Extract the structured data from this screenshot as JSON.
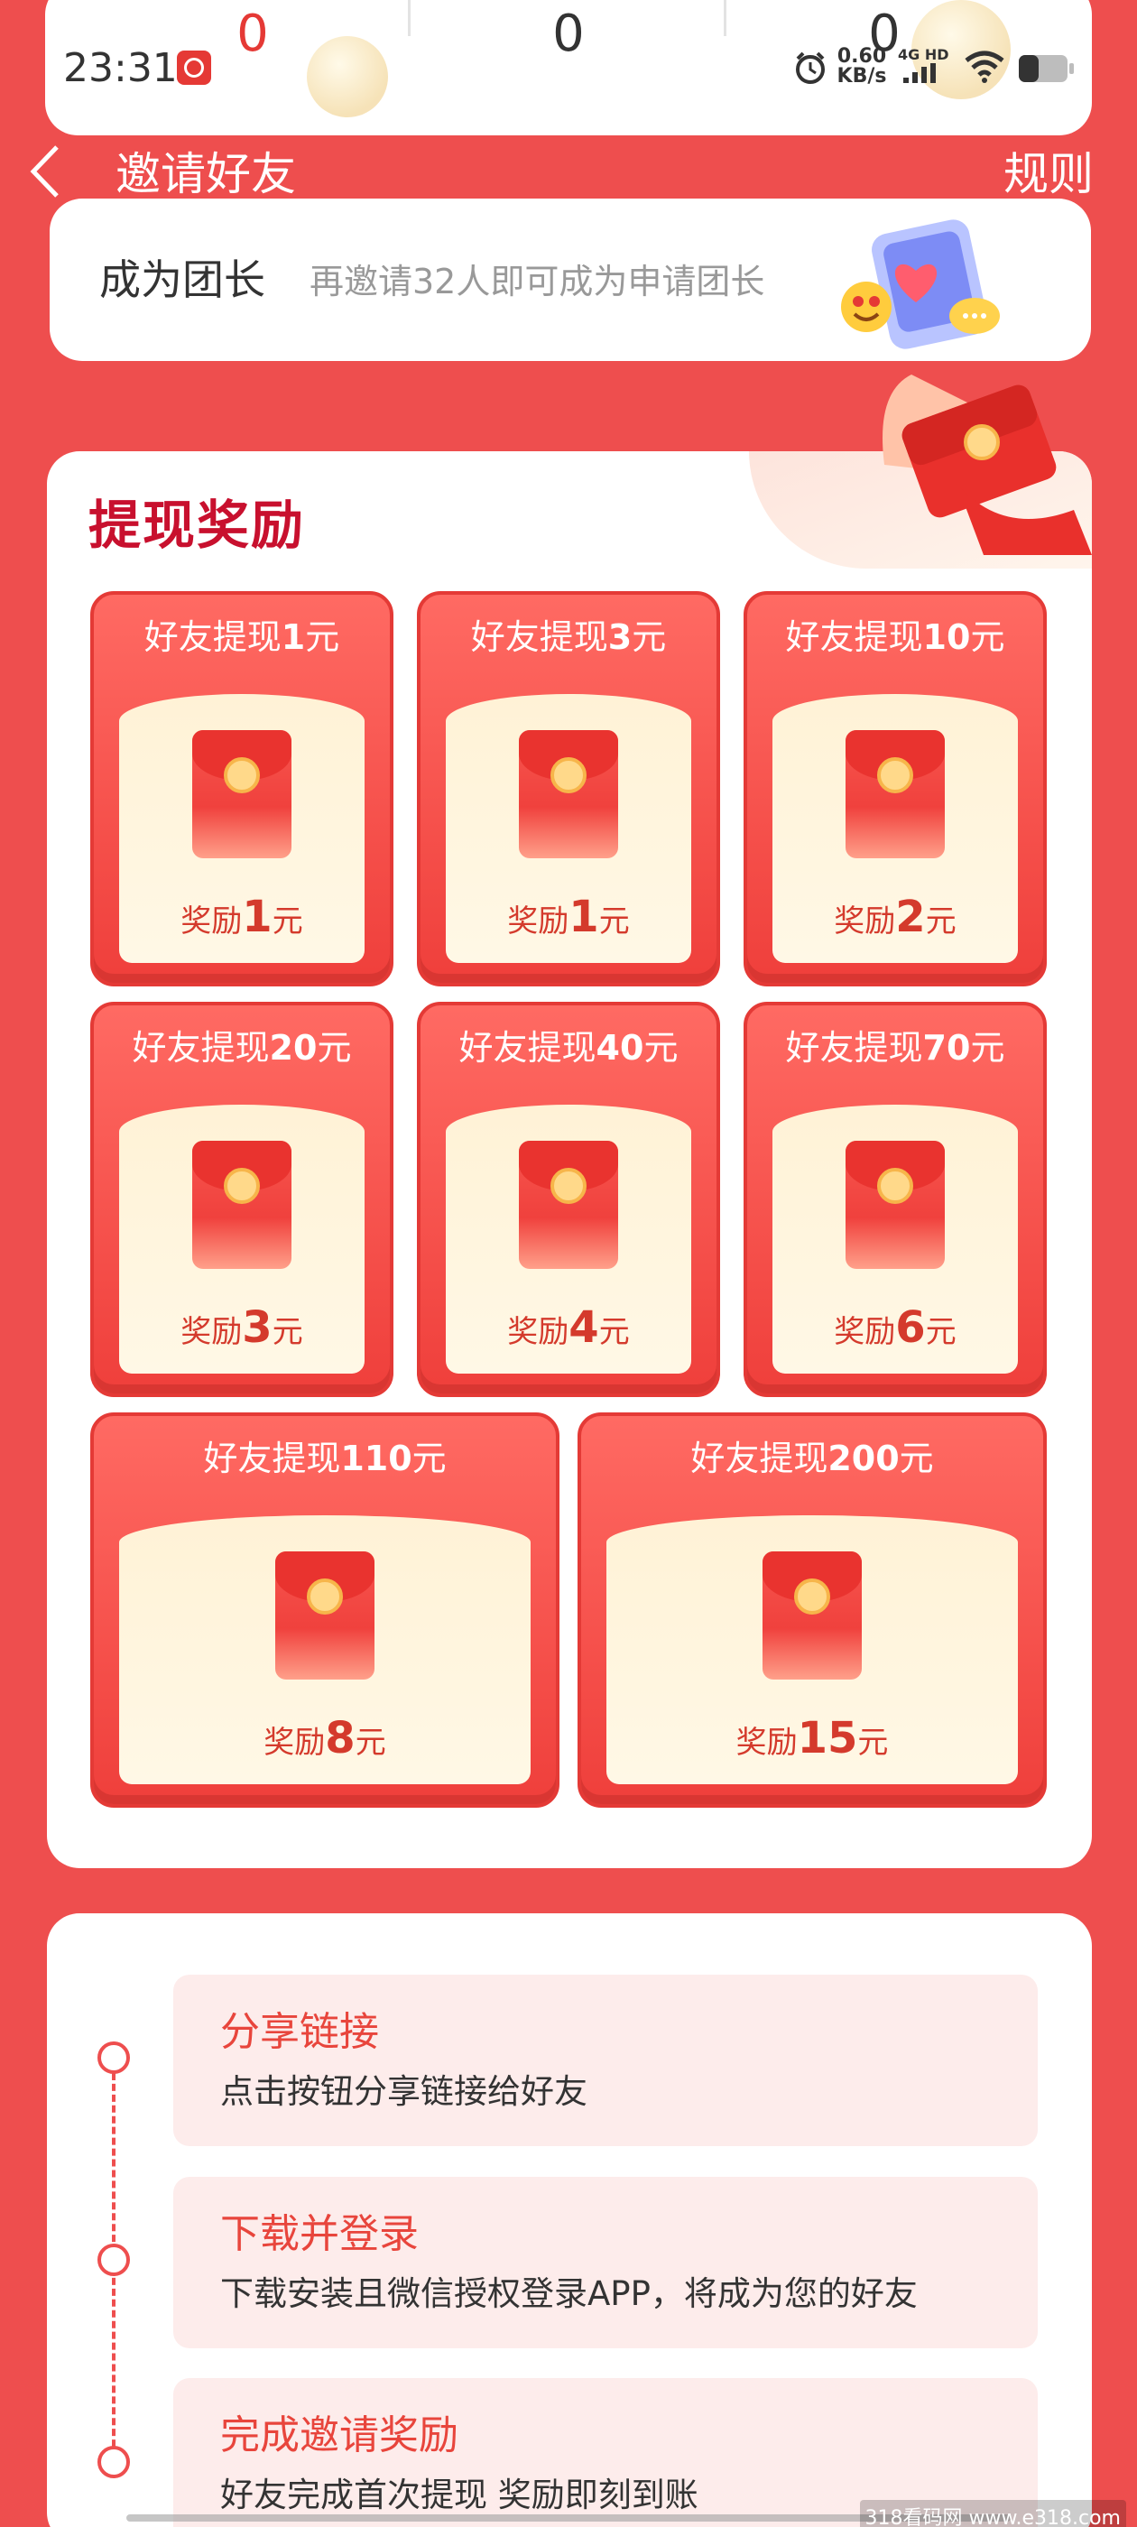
{
  "status_bar": {
    "time": "23:31",
    "net_speed_value": "0.60",
    "net_speed_unit": "KB/s",
    "network_type": "4G HD"
  },
  "stats": [
    "0",
    "0",
    "0"
  ],
  "header": {
    "title": "邀请好友",
    "rules": "规则"
  },
  "leader": {
    "title": "成为团长",
    "desc": "再邀请32人即可成为申请团长"
  },
  "rewards": {
    "title": "提现奖励",
    "head_prefix": "好友提现",
    "amount_prefix": "奖励",
    "unit": "元",
    "tiers": [
      {
        "withdraw": "1",
        "reward": "1"
      },
      {
        "withdraw": "3",
        "reward": "1"
      },
      {
        "withdraw": "10",
        "reward": "2"
      },
      {
        "withdraw": "20",
        "reward": "3"
      },
      {
        "withdraw": "40",
        "reward": "4"
      },
      {
        "withdraw": "70",
        "reward": "6"
      },
      {
        "withdraw": "110",
        "reward": "8"
      },
      {
        "withdraw": "200",
        "reward": "15"
      }
    ]
  },
  "steps": [
    {
      "title": "分享链接",
      "desc": "点击按钮分享链接给好友"
    },
    {
      "title": "下载并登录",
      "desc": "下载安装且微信授权登录APP，将成为您的好友"
    },
    {
      "title": "完成邀请奖励",
      "desc": "好友完成首次提现 奖励即刻到账"
    }
  ],
  "watermark": "318看码网 www.e318.com",
  "colors": {
    "background": "#ee4e4e",
    "accent_red": "#c8102e",
    "step_bg": "#fdeceb",
    "card_cream": "#fff2d6"
  }
}
